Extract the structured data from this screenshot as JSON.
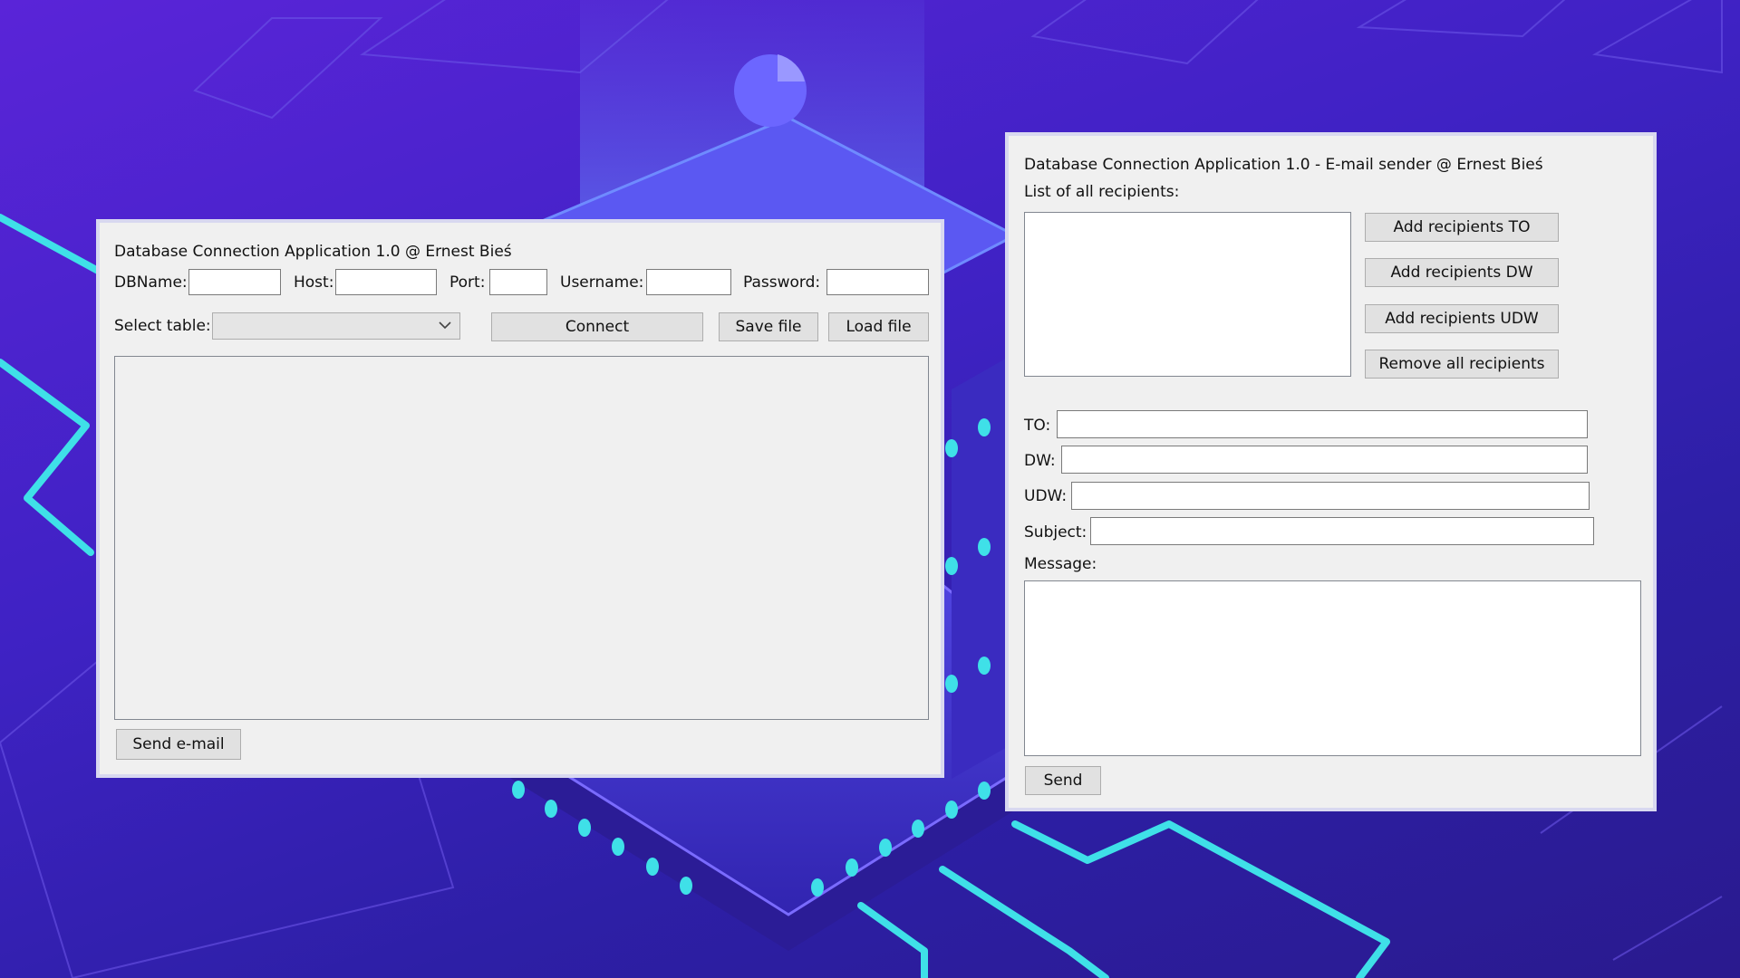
{
  "main_window": {
    "title": "Database Connection Application 1.0 @ Ernest Bieś",
    "fields": {
      "dbname_label": "DBName:",
      "host_label": "Host:",
      "port_label": "Port:",
      "username_label": "Username:",
      "password_label": "Password:",
      "dbname_value": "",
      "host_value": "",
      "port_value": "",
      "username_value": "",
      "password_value": ""
    },
    "select_table_label": "Select table:",
    "select_table_value": "",
    "connect_label": "Connect",
    "save_file_label": "Save file",
    "load_file_label": "Load file",
    "send_email_label": "Send e-mail"
  },
  "email_window": {
    "title": "Database Connection Application 1.0 - E-mail sender @ Ernest Bieś",
    "recipients_label": "List of all recipients:",
    "add_to_label": "Add recipients TO",
    "add_dw_label": "Add recipients DW",
    "add_udw_label": "Add recipients UDW",
    "remove_all_label": "Remove all recipients",
    "to_label": "TO:",
    "dw_label": "DW:",
    "udw_label": "UDW:",
    "subject_label": "Subject:",
    "message_label": "Message:",
    "to_value": "",
    "dw_value": "",
    "udw_value": "",
    "subject_value": "",
    "message_value": "",
    "send_label": "Send"
  },
  "icons": {
    "dropdown": "chevron-down-icon"
  },
  "colors": {
    "accent_cyan": "#3fe0e8",
    "background_purple": "#3f22c4"
  }
}
